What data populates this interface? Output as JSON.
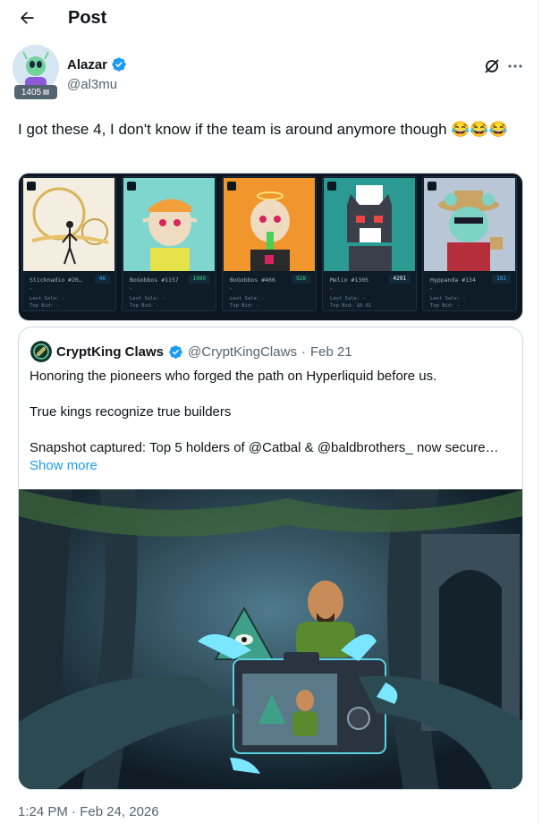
{
  "header": {
    "title": "Post"
  },
  "author": {
    "name": "Alazar",
    "handle": "@al3mu",
    "badge_count": "1405"
  },
  "tweet": {
    "text": "I got these 4, I don't know if the team is around anymore though 😂😂😂"
  },
  "nfts": [
    {
      "name": "Sticknadio #20…",
      "rank": "46",
      "dash": "-",
      "last_sale": "Last Sale: -",
      "top_bid": "Top Bid: -"
    },
    {
      "name": "BoGobbos #1157",
      "rank": "1089",
      "dash": "-",
      "last_sale": "Last Sale: -",
      "top_bid": "Top Bid: -"
    },
    {
      "name": "BoGobbos #466",
      "rank": "928",
      "dash": "-",
      "last_sale": "Last Sale: -",
      "top_bid": "Top Bid: -"
    },
    {
      "name": "Melio #1305",
      "rank": "4291",
      "dash": "-",
      "last_sale": "Last Sale: -",
      "top_bid": "Top Bid: $0.01"
    },
    {
      "name": "Hyppanda #134",
      "rank": "102",
      "dash": "-",
      "last_sale": "Last Sale: -",
      "top_bid": "Top Bid: -"
    }
  ],
  "quote": {
    "name": "CryptKing Claws",
    "handle": "@CryptKingClaws",
    "separator": "·",
    "date": "Feb 21",
    "line1": "Honoring the pioneers who forged the path on Hyperliquid before us.",
    "line2": "True kings recognize true builders",
    "line3": "Snapshot captured: Top 5 holders of @Catbal  & @baldbrothers_  now secure…",
    "show_more": "Show more"
  },
  "timestamp": "1:24 PM · Feb 24, 2026",
  "colors": {
    "accent": "#1d9bf0",
    "secondary_text": "#536471",
    "verified": "#1d9bf0"
  }
}
